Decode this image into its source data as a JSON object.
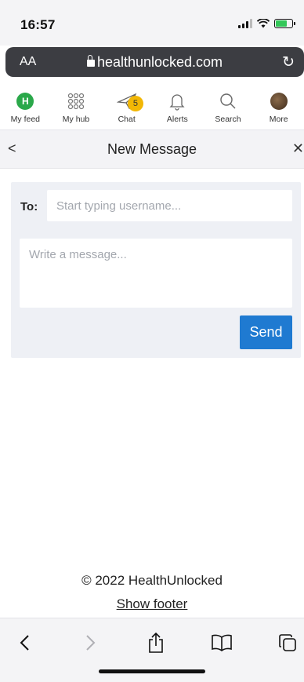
{
  "status": {
    "time": "16:57"
  },
  "browser": {
    "aa_label": "AA",
    "url": "healthunlocked.com"
  },
  "nav": {
    "items": [
      {
        "label": "My feed",
        "icon": "feed-h-icon",
        "glyph": "H"
      },
      {
        "label": "My hub",
        "icon": "hub-grid-icon"
      },
      {
        "label": "Chat",
        "icon": "paper-plane-icon",
        "badge": "5"
      },
      {
        "label": "Alerts",
        "icon": "bell-icon"
      },
      {
        "label": "Search",
        "icon": "search-icon"
      },
      {
        "label": "More",
        "icon": "avatar-icon"
      }
    ]
  },
  "header": {
    "back": "<",
    "title": "New Message",
    "close": "✕"
  },
  "compose": {
    "to_label": "To:",
    "to_placeholder": "Start typing username...",
    "message_placeholder": "Write a message...",
    "send_label": "Send"
  },
  "footer": {
    "copyright": "© 2022 HealthUnlocked",
    "show_footer": "Show footer"
  },
  "colors": {
    "accent": "#1f7ad1",
    "feed_green": "#2aa84a",
    "badge": "#f2b705"
  }
}
